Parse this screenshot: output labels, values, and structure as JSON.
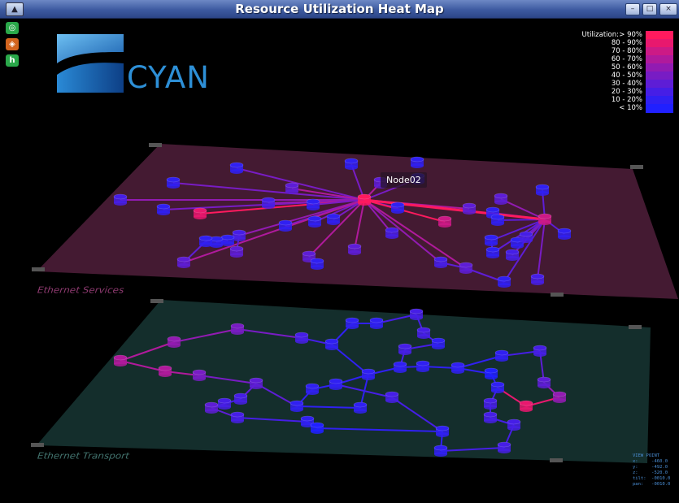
{
  "window": {
    "title": "Resource Utilization Heat Map",
    "app_icon": "app-menu-icon",
    "buttons": [
      "minimize-icon",
      "maximize-icon",
      "close-icon"
    ]
  },
  "sidebar": {
    "icons": [
      {
        "name": "reset-view-icon",
        "glyph": "◎",
        "color": "#2aa84a"
      },
      {
        "name": "layers-icon",
        "glyph": "◈",
        "color": "#d2641e"
      },
      {
        "name": "help-icon",
        "glyph": "h",
        "color": "#2aa84a"
      }
    ]
  },
  "logo": {
    "text": "CYAN"
  },
  "legend": {
    "heading": "Utilization:",
    "rows": [
      {
        "label": "> 90%",
        "color": "#ff1a5e"
      },
      {
        "label": "80 - 90%",
        "color": "#e8186e"
      },
      {
        "label": "70 - 80%",
        "color": "#cc1a86"
      },
      {
        "label": "60 - 70%",
        "color": "#b01a9c"
      },
      {
        "label": "50 - 60%",
        "color": "#921bb2"
      },
      {
        "label": "40 - 50%",
        "color": "#781cc4"
      },
      {
        "label": "30 - 40%",
        "color": "#5e1dd6"
      },
      {
        "label": "20 - 30%",
        "color": "#461ee6"
      },
      {
        "label": "10 - 20%",
        "color": "#3020f2"
      },
      {
        "label": "< 10%",
        "color": "#2020ff"
      }
    ]
  },
  "tooltip": "Node02",
  "layers": {
    "services": {
      "label": "Ethernet Services",
      "fill": "#4a1c36"
    },
    "transport": {
      "label": "Ethernet Transport",
      "fill": "#15302e"
    }
  },
  "viewpoint": {
    "heading": "VIEW POINT",
    "rows": [
      "x:     -460.0",
      "y:     -492.0",
      "z:     -520.0",
      "tilt:  -0010.0",
      "pan:   -0010.0"
    ]
  }
}
